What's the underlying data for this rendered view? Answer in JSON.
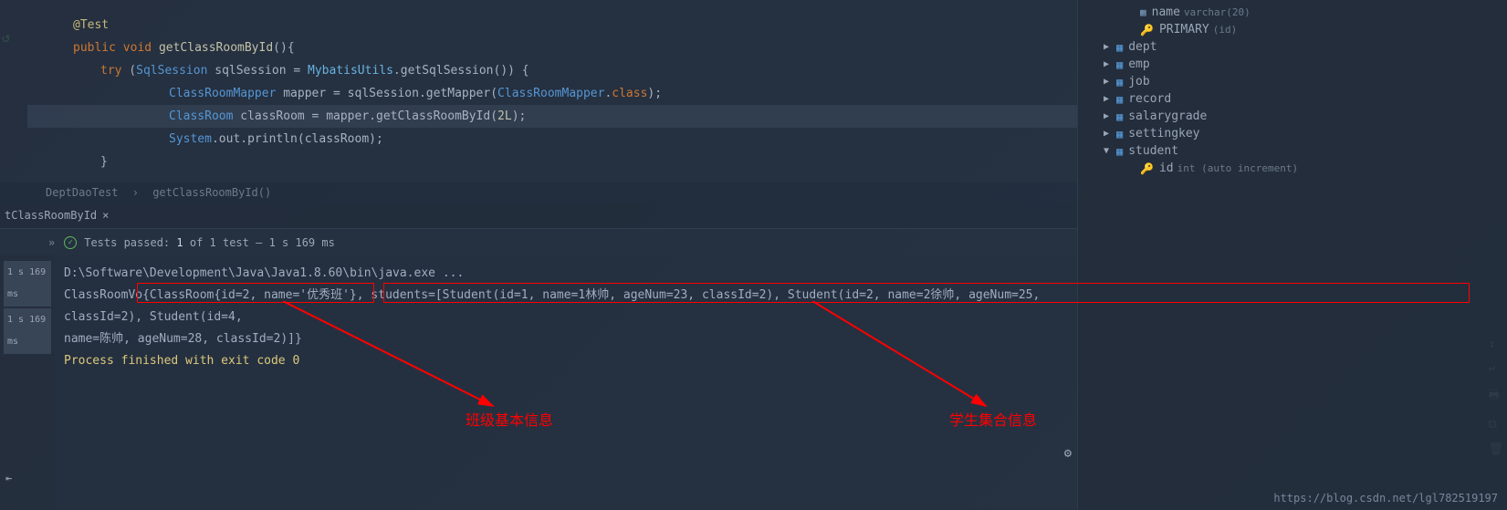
{
  "editor": {
    "annotation": "@Test",
    "sig_public": "public",
    "sig_void": "void",
    "sig_method": "getClassRoomById",
    "sig_parens": "(){",
    "try_kw": "try",
    "try_open": " (",
    "sql_session_type": "SqlSession",
    "sql_session_var": " sqlSession = ",
    "mybatis_utils": "MybatisUtils",
    "get_session": ".getSqlSession()) {",
    "mapper_type": "ClassRoomMapper",
    "mapper_var": " mapper = sqlSession.getMapper(",
    "mapper_class": "ClassRoomMapper",
    "dot_class": ".",
    "class_kw": "class",
    "close_paren1": ");",
    "classroom_type": "ClassRoom",
    "classroom_var": " classRoom = mapper.getClassRoomById(",
    "arg_2l": "2L",
    "close_paren2": ");",
    "system": "System",
    "out_println": ".out.println(classRoom);",
    "brace_close": "}"
  },
  "breadcrumb": {
    "class": "DeptDaoTest",
    "sep": "›",
    "method": "getClassRoomById()"
  },
  "tab": {
    "label": "tClassRoomById",
    "close": "×"
  },
  "test_status": {
    "passed_label": "Tests passed:",
    "count": "1",
    "of": "of 1 test",
    "duration": "– 1 s 169 ms",
    "chevrons": "»"
  },
  "console": {
    "time1": "1 s 169 ms",
    "time2": "1 s 169 ms",
    "java_path": "D:\\Software\\Development\\Java\\Java1.8.60\\bin\\java.exe ...",
    "output_line": "ClassRoomVo{ClassRoom{id=2, name='优秀班'}, students=[Student(id=1, name=1林帅, ageNum=23, classId=2), Student(id=2, name=2徐帅, ageNum=25, classId=2), Student(id=4,",
    "output_line2": " name=陈帅, ageNum=28, classId=2)]}",
    "blank": "",
    "exit_msg": "Process finished with exit code 0"
  },
  "annotations": {
    "label1": "班级基本信息",
    "label2": "学生集合信息"
  },
  "db_tree": {
    "col_name": "name",
    "col_name_type": "varchar(20)",
    "primary": "PRIMARY",
    "primary_cols": "(id)",
    "tables": [
      "dept",
      "emp",
      "job",
      "record",
      "salarygrade",
      "settingkey",
      "student"
    ],
    "student_col": "id",
    "student_col_type": "int (auto increment)"
  },
  "watermark": "https://blog.csdn.net/lgl782519197"
}
